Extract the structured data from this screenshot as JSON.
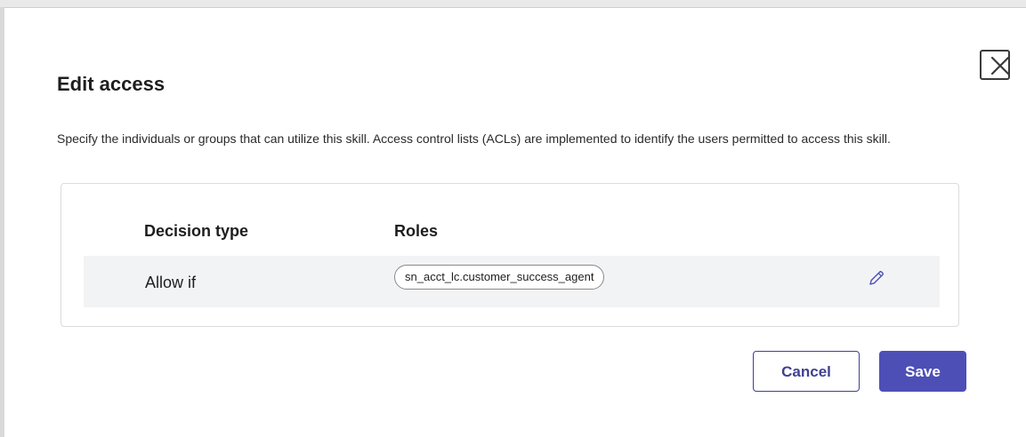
{
  "dialog": {
    "title": "Edit access",
    "description": "Specify the individuals or groups that can utilize this skill. Access control lists (ACLs) are implemented to identify the users permitted to access this skill.",
    "close_icon": "close-x-icon"
  },
  "acl_table": {
    "columns": [
      "Decision type",
      "Roles"
    ],
    "rows": [
      {
        "decision_type": "Allow if",
        "roles": [
          "sn_acct_lc.customer_success_agent"
        ],
        "edit_icon": "pencil-icon"
      }
    ]
  },
  "actions": {
    "cancel_label": "Cancel",
    "save_label": "Save"
  },
  "colors": {
    "primary": "#4d4fb6",
    "primary_outline": "#3e4190",
    "row_background": "#f2f3f5",
    "text": "#1e1e1e"
  }
}
